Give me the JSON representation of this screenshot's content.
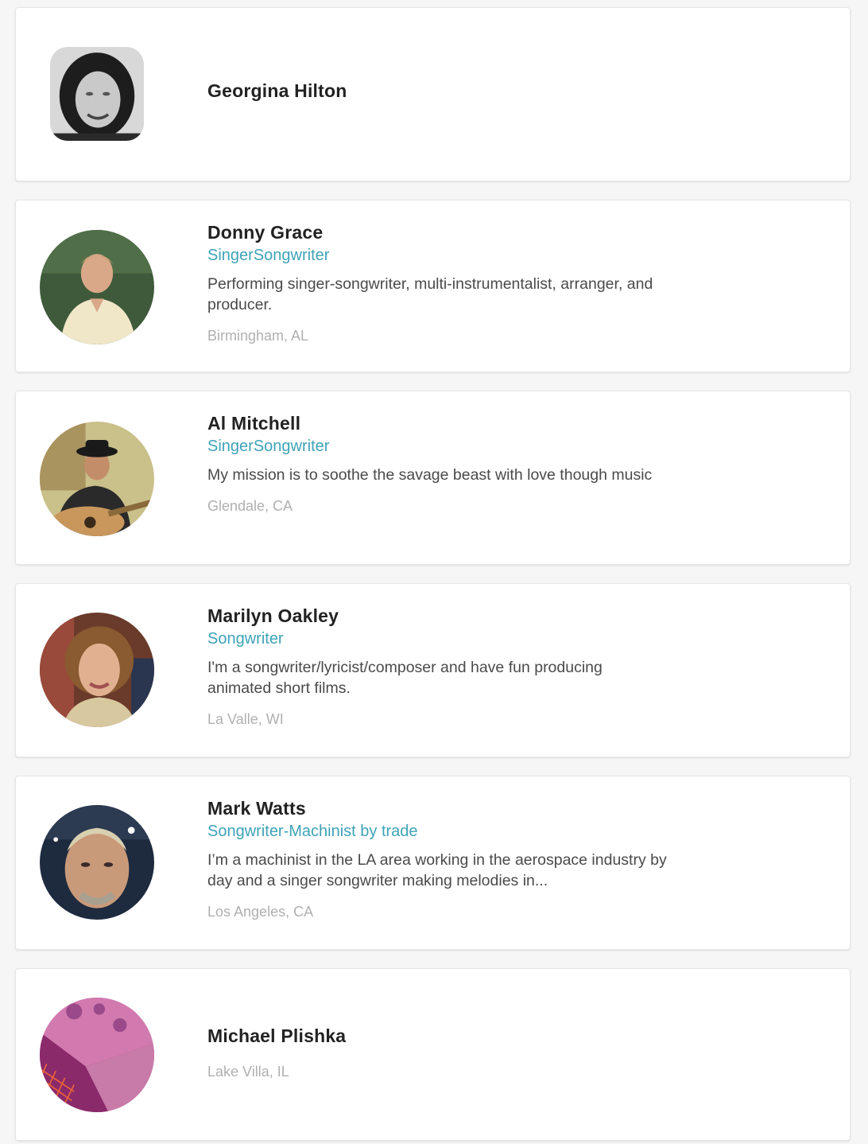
{
  "profiles": [
    {
      "name": "Georgina Hilton",
      "avatar": "portrait-photo-grayscale",
      "role": "",
      "bio": "",
      "location": ""
    },
    {
      "name": "Donny Grace",
      "avatar": "portrait-photo",
      "role": "SingerSongwriter",
      "bio": "Performing singer-songwriter, multi-instrumentalist, arranger, and producer.",
      "location": "Birmingham, AL"
    },
    {
      "name": "Al Mitchell",
      "avatar": "portrait-photo-guitar",
      "role": "SingerSongwriter",
      "bio": "My mission is to soothe the savage beast with love though music",
      "location": "Glendale, CA"
    },
    {
      "name": "Marilyn Oakley",
      "avatar": "portrait-photo",
      "role": "Songwriter",
      "bio": "I'm a songwriter/lyricist/composer and have fun producing animated short films.",
      "location": "La Valle, WI"
    },
    {
      "name": "Mark Watts",
      "avatar": "portrait-photo",
      "role": "Songwriter-Machinist by trade",
      "bio": "I’m a machinist in the LA area working in the aerospace industry by day and a singer songwriter making melodies in...",
      "location": "Los Angeles, CA"
    },
    {
      "name": "Michael Plishka",
      "avatar": "abstract-pattern-placeholder",
      "role": "",
      "bio": "",
      "location": "Lake Villa, IL"
    }
  ],
  "colors": {
    "accent": "#3ea3b7",
    "name": "#222222",
    "bio": "#4a4a4a",
    "location": "#b0b0b0",
    "background": "#f6f6f6"
  }
}
